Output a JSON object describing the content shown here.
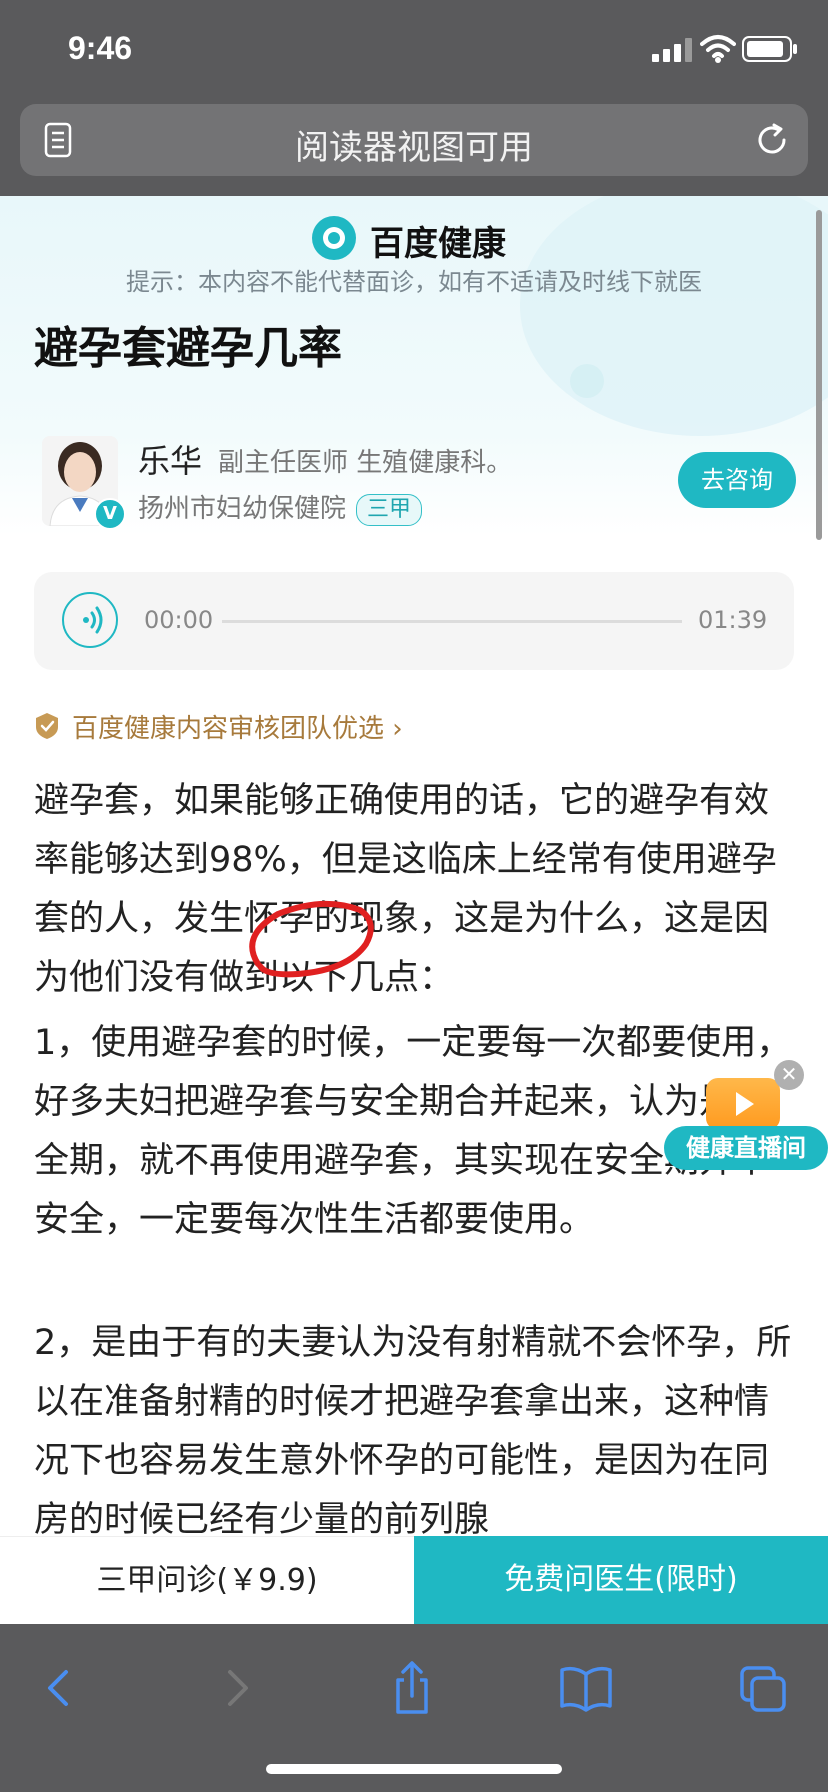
{
  "status_bar": {
    "time": "9:46"
  },
  "url_bar": {
    "text": "阅读器视图可用"
  },
  "header": {
    "brand": "百度健康",
    "hint": "提示：本内容不能代替面诊，如有不适请及时线下就医"
  },
  "article": {
    "title": "避孕套避孕几率",
    "paragraphs": [
      "避孕套，如果能够正确使用的话，它的避孕有效率能够达到98%，但是这临床上经常有使用避孕套的人，发生怀孕的现象，这是为什么，这是因为他们没有做到以下几点：",
      "1，使用避孕套的时候，一定要每一次都要使用，好多夫妇把避孕套与安全期合并起来，认为是安全期，就不再使用避孕套，其实现在安全期并不安全，一定要每次性生活都要使用。",
      "2，是由于有的夫妻认为没有射精就不会怀孕，所以在准备射精的时候才把避孕套拿出来，这种情况下也容易发生意外怀孕的可能性，是因为在同房的时候已经有少量的前列腺"
    ]
  },
  "doctor": {
    "name": "乐华",
    "title": "副主任医师  生殖健康科。",
    "hospital": "扬州市妇幼保健院",
    "grade": "三甲",
    "consult_label": "去咨询"
  },
  "audio": {
    "current": "00:00",
    "duration": "01:39",
    "progress": 0
  },
  "review": {
    "label": "百度健康内容审核团队优选"
  },
  "floating": {
    "label": "健康直播间"
  },
  "actions": {
    "left": "三甲问诊(￥9.9)",
    "right": "免费问医生(限时)"
  },
  "colors": {
    "accent": "#1fb8c3",
    "chrome": "#5a5a5c",
    "toolbar_icon": "#4a8ef0",
    "annotation": "#e02020"
  },
  "icons": [
    "reader-icon",
    "reload-icon",
    "back-icon",
    "forward-icon",
    "share-icon",
    "bookmarks-icon",
    "tabs-icon"
  ]
}
